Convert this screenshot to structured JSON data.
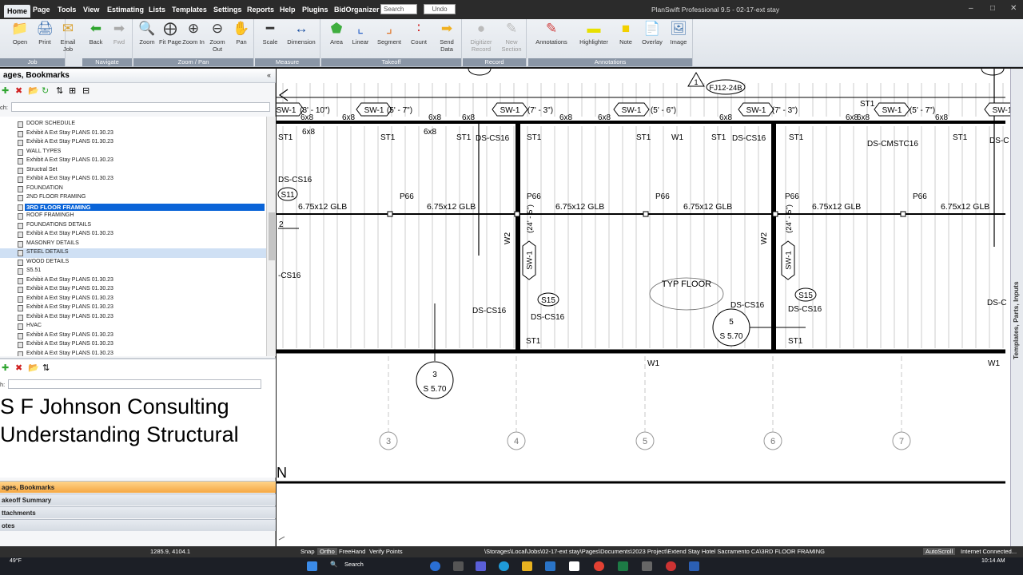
{
  "menubar": {
    "items": [
      "Home",
      "Page",
      "Tools",
      "View",
      "Estimating",
      "Lists",
      "Templates",
      "Settings",
      "Reports",
      "Help",
      "Plugins",
      "BidOrganizer"
    ],
    "search_placeholder": "Search",
    "undo_label": "Undo",
    "app_title": "PlanSwift Professional 9.5 - 02-17-ext stay",
    "window_controls": [
      "–",
      "□",
      "✕"
    ]
  },
  "ribbon": {
    "groups": [
      {
        "label": "Job",
        "buttons": [
          "Open",
          "Print",
          "Email Job"
        ]
      },
      {
        "label": "Navigate",
        "buttons": [
          "Back",
          "Fwd"
        ]
      },
      {
        "label": "Zoom / Pan",
        "buttons": [
          "Zoom",
          "Fit Page",
          "Zoom In",
          "Zoom Out",
          "Pan"
        ]
      },
      {
        "label": "Measure",
        "buttons": [
          "Scale",
          "Dimension"
        ]
      },
      {
        "label": "Takeoff",
        "buttons": [
          "Area",
          "Linear",
          "Segment",
          "Count",
          "Send Data"
        ]
      },
      {
        "label": "Record",
        "buttons": [
          "Digitizer Record",
          "New Section"
        ]
      },
      {
        "label": "Annotations",
        "buttons": [
          "Annotations",
          "Highlighter",
          "Note",
          "Overlay",
          "Image"
        ]
      }
    ]
  },
  "left_panel": {
    "title": "ages, Bookmarks",
    "search_label": "ch:",
    "tree_items": [
      "DOOR SCHEDULE",
      "Exhibit A Ext Stay PLANS 01.30.23",
      "Exhibit A Ext Stay PLANS 01.30.23",
      "WALL TYPES",
      "Exhibit A Ext Stay PLANS 01.30.23",
      "Structral Set",
      "Exhibit A Ext Stay PLANS 01.30.23",
      "FOUNDATION",
      "2ND FLOOR FRAMING",
      "3RD FLOOR FRAMING",
      "ROOF FRAMINGH",
      "FOUNDATIONS DETAILS",
      "Exhibit A Ext Stay PLANS 01.30.23",
      "MASONRY DETAILS",
      "STEEL DETAILS",
      "WOOD DETAILS",
      "S5.51",
      "Exhibit A Ext Stay PLANS 01.30.23",
      "Exhibit A Ext Stay PLANS 01.30.23",
      "Exhibit A Ext Stay PLANS 01.30.23",
      "Exhibit A Ext Stay PLANS 01.30.23",
      "Exhibit A Ext Stay PLANS 01.30.23",
      "HVAC",
      "Exhibit A Ext Stay PLANS 01.30.23",
      "Exhibit A Ext Stay PLANS 01.30.23",
      "Exhibit A Ext Stay PLANS 01.30.23"
    ],
    "selected_item": "3RD FLOOR FRAMING",
    "lower_search_label": "h:",
    "overlay_line1": "S F Johnson Consulting",
    "overlay_line2": "Understanding Structural",
    "nav_tabs": [
      "ages, Bookmarks",
      "akeoff Summary",
      "ttachments",
      "otes"
    ]
  },
  "drawing": {
    "shear_walls": [
      "SW-1",
      "SW-1",
      "SW-1",
      "SW-1",
      "SW-1",
      "SW-1",
      "SW-1"
    ],
    "shear_wall_lengths": [
      "(3' - 10\")",
      "(5' - 7\")",
      "(7' - 3\")",
      "(5' - 6\")",
      "(7' - 3\")",
      "(5' - 7\")"
    ],
    "header_label": "6x8",
    "strap_label": "ST1",
    "wall_label": "W1",
    "holdown_label": "DS-CS16",
    "holdown_label_alt": "DS-CMSTC16",
    "partial_holdown": "DS-C",
    "beam_label": "6.75x12 GLB",
    "post_label": "P66",
    "s11": "S11",
    "s15": "S15",
    "w2": "W2",
    "vertical_sw_length": "(24' - 5\")",
    "typ_floor": "TYP FLOOR",
    "revision_tag": "1",
    "revision_cloud": "FJ12-24B",
    "detail3_num": "3",
    "detail3_sheet": "S 5.70",
    "detail5_num": "5",
    "detail5_sheet": "S 5.70",
    "grid_labels": [
      "3",
      "4",
      "5",
      "6",
      "7"
    ],
    "edge_labels": [
      "2",
      "N",
      "-CS16"
    ]
  },
  "right_tab": "Templates, Parts, Inputs",
  "statusbar": {
    "coords": "1285.9, 4104.1",
    "toggles": [
      "Snap",
      "Ortho",
      "FreeHand",
      "Verify Points"
    ],
    "path": "\\Storages\\Local\\Jobs\\02-17-ext stay\\Pages\\Documents\\2023 Project\\Extend Stay Hotel Sacramento CA\\3RD FLOOR FRAMING",
    "autoscroll": "AutoScroll",
    "connection": "Internet Connected..."
  },
  "taskbar": {
    "temperature": "49°F",
    "search": "Search",
    "time": "10:14 AM"
  }
}
